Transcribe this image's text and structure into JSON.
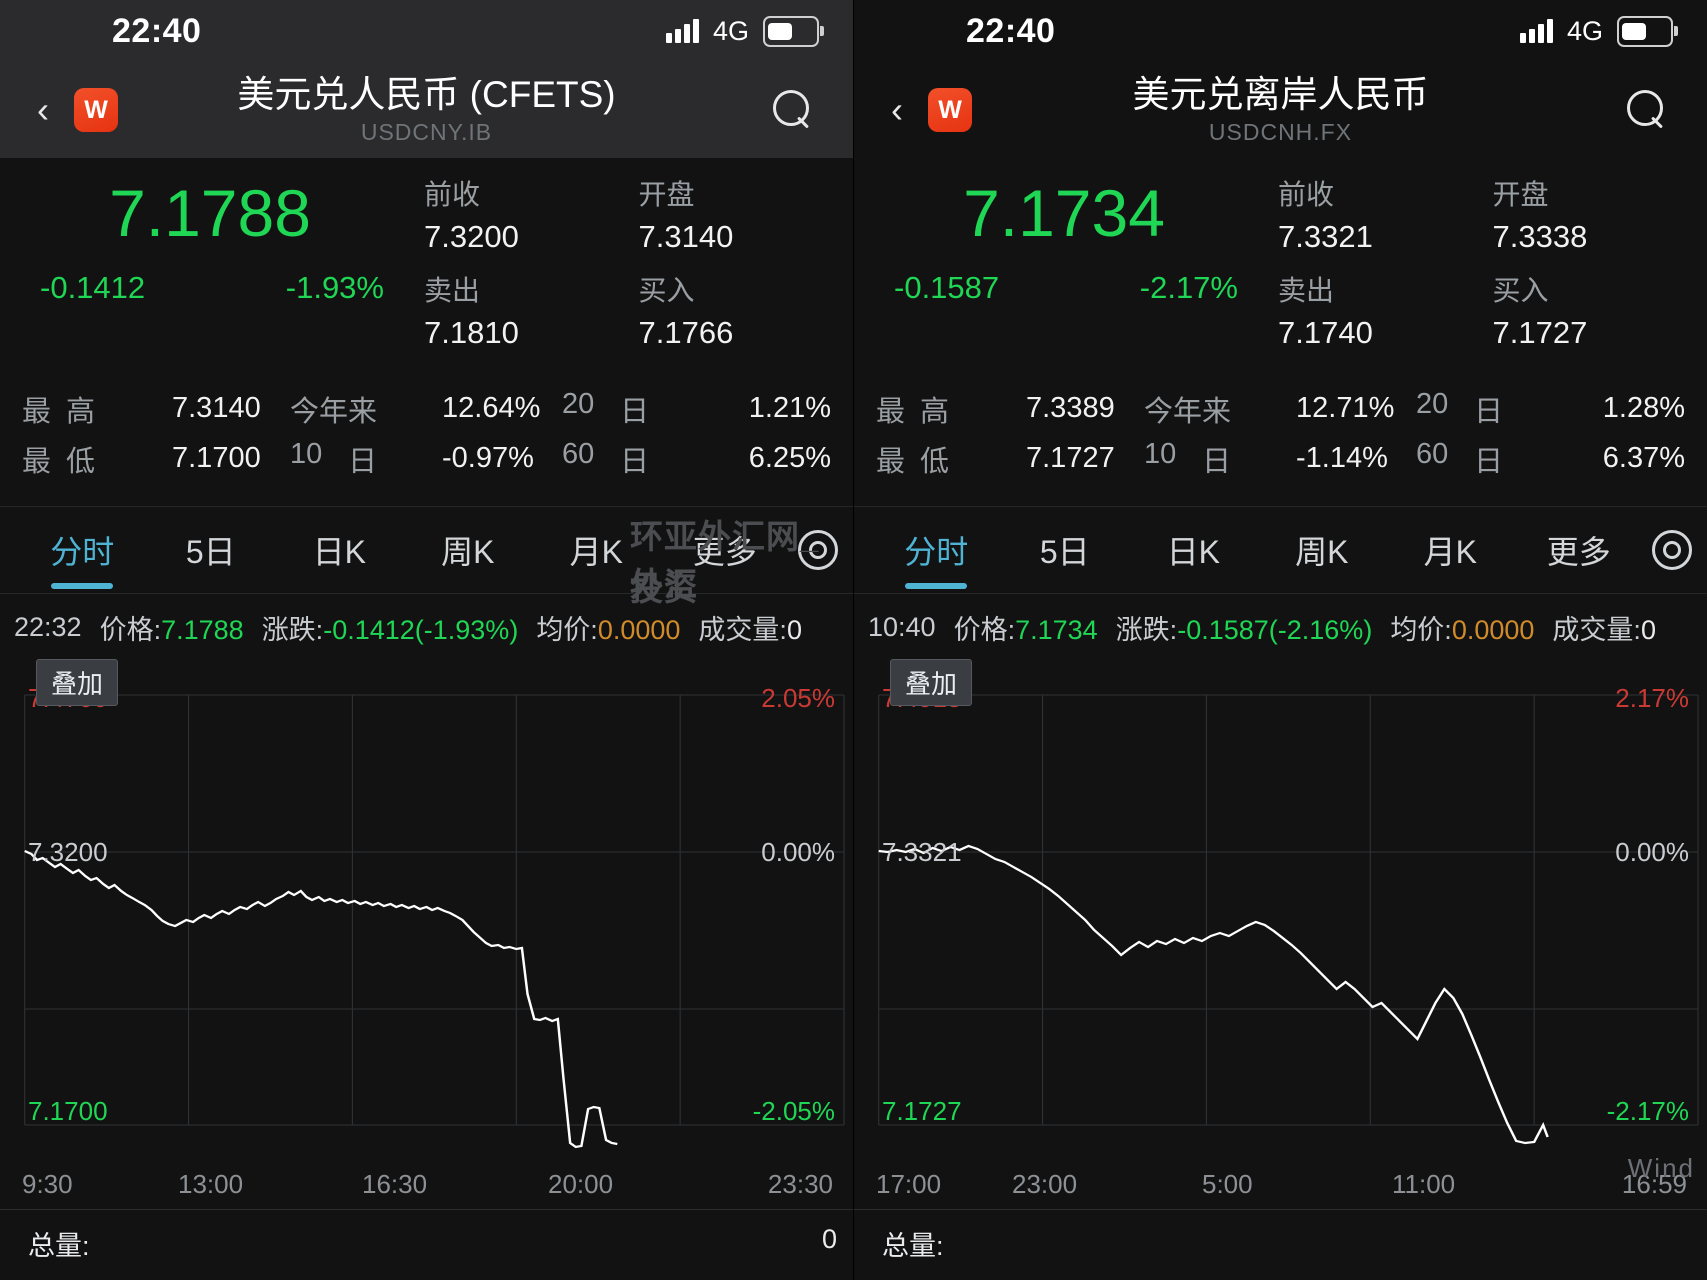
{
  "watermark": {
    "line1": "环亚外汇网_外汇",
    "line2": "投资",
    "brand": "Wind"
  },
  "panels": [
    {
      "status": {
        "time": "22:40",
        "network": "4G",
        "signal_icon": "signal-bars-icon",
        "battery_icon": "battery-icon"
      },
      "nav": {
        "back_icon": "chevron-left-icon",
        "logo_text": "W",
        "title": "美元兑人民币 (CFETS)",
        "subtitle": "USDCNY.IB",
        "search_icon": "search-icon"
      },
      "quote": {
        "price": "7.1788",
        "change": "-0.1412",
        "change_pct": "-1.93%",
        "cells": [
          {
            "label": "前收",
            "value": "7.3200"
          },
          {
            "label": "开盘",
            "value": "7.3140"
          },
          {
            "label": "卖出",
            "value": "7.1810"
          },
          {
            "label": "买入",
            "value": "7.1766"
          }
        ]
      },
      "stats": [
        {
          "k1a": "最",
          "k1b": "高",
          "v1": "7.3140",
          "k2": "今年来",
          "v2": "12.64%",
          "k3a": "20",
          "k3b": "日",
          "v3": "1.21%"
        },
        {
          "k1a": "最",
          "k1b": "低",
          "v1": "7.1700",
          "k2a": "10",
          "k2b": "日",
          "v2": "-0.97%",
          "k3a": "60",
          "k3b": "日",
          "v3": "6.25%"
        }
      ],
      "tabs": [
        {
          "label": "分时",
          "active": true
        },
        {
          "label": "5日",
          "active": false
        },
        {
          "label": "日K",
          "active": false
        },
        {
          "label": "周K",
          "active": false
        },
        {
          "label": "月K",
          "active": false
        },
        {
          "label": "更多",
          "active": false
        }
      ],
      "gear_icon": "gear-icon",
      "chartinfo": {
        "time": "22:32",
        "price_label": "价格:",
        "price": "7.1788",
        "change_label": "涨跌:",
        "change": "-0.1412(-1.93%)",
        "avg_label": "均价:",
        "avg": "0.0000",
        "vol_label": "成交量:",
        "vol": "0"
      },
      "overlay_button": "叠加",
      "chart_labels": {
        "top_price": "7.4700",
        "top_pct": "2.05%",
        "mid_price": "7.3200",
        "mid_pct": "0.00%",
        "bot_price": "7.1700",
        "bot_pct": "-2.05%"
      },
      "xaxis": [
        "9:30",
        "13:00",
        "16:30",
        "20:00",
        "23:30"
      ],
      "footer": {
        "label": "总量:",
        "value": "0"
      }
    },
    {
      "status": {
        "time": "22:40",
        "network": "4G",
        "signal_icon": "signal-bars-icon",
        "battery_icon": "battery-icon"
      },
      "nav": {
        "back_icon": "chevron-left-icon",
        "logo_text": "W",
        "title": "美元兑离岸人民币",
        "subtitle": "USDCNH.FX",
        "search_icon": "search-icon"
      },
      "quote": {
        "price": "7.1734",
        "change": "-0.1587",
        "change_pct": "-2.17%",
        "cells": [
          {
            "label": "前收",
            "value": "7.3321"
          },
          {
            "label": "开盘",
            "value": "7.3338"
          },
          {
            "label": "卖出",
            "value": "7.1740"
          },
          {
            "label": "买入",
            "value": "7.1727"
          }
        ]
      },
      "stats": [
        {
          "k1a": "最",
          "k1b": "高",
          "v1": "7.3389",
          "k2": "今年来",
          "v2": "12.71%",
          "k3a": "20",
          "k3b": "日",
          "v3": "1.28%"
        },
        {
          "k1a": "最",
          "k1b": "低",
          "v1": "7.1727",
          "k2a": "10",
          "k2b": "日",
          "v2": "-1.14%",
          "k3a": "60",
          "k3b": "日",
          "v3": "6.37%"
        }
      ],
      "tabs": [
        {
          "label": "分时",
          "active": true
        },
        {
          "label": "5日",
          "active": false
        },
        {
          "label": "日K",
          "active": false
        },
        {
          "label": "周K",
          "active": false
        },
        {
          "label": "月K",
          "active": false
        },
        {
          "label": "更多",
          "active": false
        }
      ],
      "gear_icon": "gear-icon",
      "chartinfo": {
        "time": "10:40",
        "price_label": "价格:",
        "price": "7.1734",
        "change_label": "涨跌:",
        "change": "-0.1587(-2.16%)",
        "avg_label": "均价:",
        "avg": "0.0000",
        "vol_label": "成交量:",
        "vol": "0"
      },
      "overlay_button": "叠加",
      "chart_labels": {
        "top_price": "7.4915",
        "top_pct": "2.17%",
        "mid_price": "7.3321",
        "mid_pct": "0.00%",
        "bot_price": "7.1727",
        "bot_pct": "-2.17%"
      },
      "xaxis": [
        "17:00",
        "23:00",
        "5:00",
        "11:00",
        "16:59"
      ],
      "footer": {
        "label": "总量:",
        "value": ""
      }
    }
  ],
  "chart_data": [
    {
      "type": "line",
      "title": "美元兑人民币 (CFETS) 分时",
      "xlabel": "",
      "ylabel": "价格",
      "ylim": [
        7.17,
        7.47
      ],
      "y2lim": [
        -2.05,
        2.05
      ],
      "yticks": [
        "7.4700",
        "7.3200",
        "7.1700"
      ],
      "y2ticks": [
        "2.05%",
        "0.00%",
        "-2.05%"
      ],
      "xticks": [
        "9:30",
        "13:00",
        "16:30",
        "20:00",
        "23:30"
      ],
      "grid": true,
      "legend": "none",
      "series": [
        {
          "name": "价格",
          "color": "#ffffff",
          "x": [
            0,
            1,
            2,
            3,
            4,
            5,
            6,
            7,
            8,
            9,
            10,
            11,
            12,
            13,
            14,
            15,
            16,
            17,
            18,
            19,
            20,
            21,
            22,
            23,
            24,
            25,
            26,
            27,
            28,
            29,
            30,
            31,
            32,
            33,
            34,
            35,
            36,
            37,
            38,
            39,
            40,
            41,
            42,
            43,
            44,
            45,
            46,
            47,
            48,
            49,
            50,
            51,
            52,
            53,
            54,
            55,
            56,
            57,
            58,
            59,
            60,
            61,
            62,
            63,
            64,
            65,
            66,
            67,
            68,
            69,
            70,
            71,
            72,
            73,
            74,
            75,
            76,
            77,
            78,
            79,
            80,
            81,
            82,
            83,
            84,
            85,
            86,
            87,
            88,
            89,
            90,
            91,
            92,
            93,
            94,
            95,
            96,
            97,
            98,
            99
          ],
          "values": [
            7.3205,
            7.319,
            7.316,
            7.317,
            7.3145,
            7.3125,
            7.314,
            7.3115,
            7.3095,
            7.311,
            7.308,
            7.306,
            7.307,
            7.304,
            7.302,
            7.3035,
            7.3005,
            7.2985,
            7.297,
            7.295,
            7.2935,
            7.291,
            7.288,
            7.2855,
            7.284,
            7.283,
            7.2845,
            7.286,
            7.285,
            7.287,
            7.2885,
            7.287,
            7.289,
            7.2905,
            7.289,
            7.291,
            7.2925,
            7.2915,
            7.2935,
            7.295,
            7.293,
            7.2945,
            7.2965,
            7.298,
            7.3,
            7.2985,
            7.3005,
            7.2975,
            7.296,
            7.2975,
            7.2955,
            7.2965,
            7.295,
            7.296,
            7.2945,
            7.2955,
            7.294,
            7.295,
            7.2935,
            7.2945,
            7.293,
            7.294,
            7.2925,
            7.2935,
            7.292,
            7.293,
            7.2915,
            7.2925,
            7.291,
            7.292,
            7.2905,
            7.2895,
            7.288,
            7.286,
            7.283,
            7.28,
            7.277,
            7.2745,
            7.273,
            7.2735,
            7.272,
            7.2725,
            7.2715,
            7.272,
            7.25,
            7.238,
            7.2375,
            7.2385,
            7.237,
            7.238,
            7.21,
            7.179,
            7.177,
            7.1775,
            7.195,
            7.196,
            7.1955,
            7.18,
            7.179,
            7.1788
          ]
        }
      ]
    },
    {
      "type": "line",
      "title": "美元兑离岸人民币 分时",
      "xlabel": "",
      "ylabel": "价格",
      "ylim": [
        7.1727,
        7.4915
      ],
      "y2lim": [
        -2.17,
        2.17
      ],
      "yticks": [
        "7.4915",
        "7.3321",
        "7.1727"
      ],
      "y2ticks": [
        "2.17%",
        "0.00%",
        "-2.17%"
      ],
      "xticks": [
        "17:00",
        "23:00",
        "5:00",
        "11:00",
        "16:59"
      ],
      "grid": true,
      "legend": "none",
      "series": [
        {
          "name": "价格",
          "color": "#ffffff",
          "x": [
            0,
            1,
            2,
            3,
            4,
            5,
            6,
            7,
            8,
            9,
            10,
            11,
            12,
            13,
            14,
            15,
            16,
            17,
            18,
            19,
            20,
            21,
            22,
            23,
            24,
            25,
            26,
            27,
            28,
            29,
            30,
            31,
            32,
            33,
            34,
            35,
            36,
            37,
            38,
            39,
            40,
            41,
            42,
            43,
            44,
            45,
            46,
            47,
            48,
            49,
            50,
            51,
            52,
            53,
            54,
            55,
            56,
            57,
            58,
            59,
            60,
            61,
            62,
            63,
            64,
            65,
            66,
            67,
            68,
            69,
            70,
            71,
            72,
            73,
            74,
            75
          ],
          "values": [
            7.3325,
            7.332,
            7.333,
            7.3322,
            7.3335,
            7.3318,
            7.334,
            7.3325,
            7.3345,
            7.333,
            7.335,
            7.3338,
            7.332,
            7.33,
            7.329,
            7.327,
            7.325,
            7.323,
            7.3205,
            7.318,
            7.315,
            7.312,
            7.3085,
            7.305,
            7.301,
            7.2975,
            7.294,
            7.2905,
            7.293,
            7.2955,
            7.2935,
            7.296,
            7.2945,
            7.297,
            7.295,
            7.2975,
            7.296,
            7.2985,
            7.3,
            7.2985,
            7.301,
            7.303,
            7.305,
            7.3035,
            7.301,
            7.298,
            7.295,
            7.2915,
            7.288,
            7.284,
            7.28,
            7.276,
            7.279,
            7.276,
            7.272,
            7.268,
            7.27,
            7.266,
            7.262,
            7.258,
            7.254,
            7.262,
            7.27,
            7.276,
            7.272,
            7.265,
            7.256,
            7.246,
            7.236,
            7.226,
            7.216,
            7.206,
            7.196,
            7.186,
            7.178,
            7.1734
          ]
        }
      ]
    }
  ]
}
